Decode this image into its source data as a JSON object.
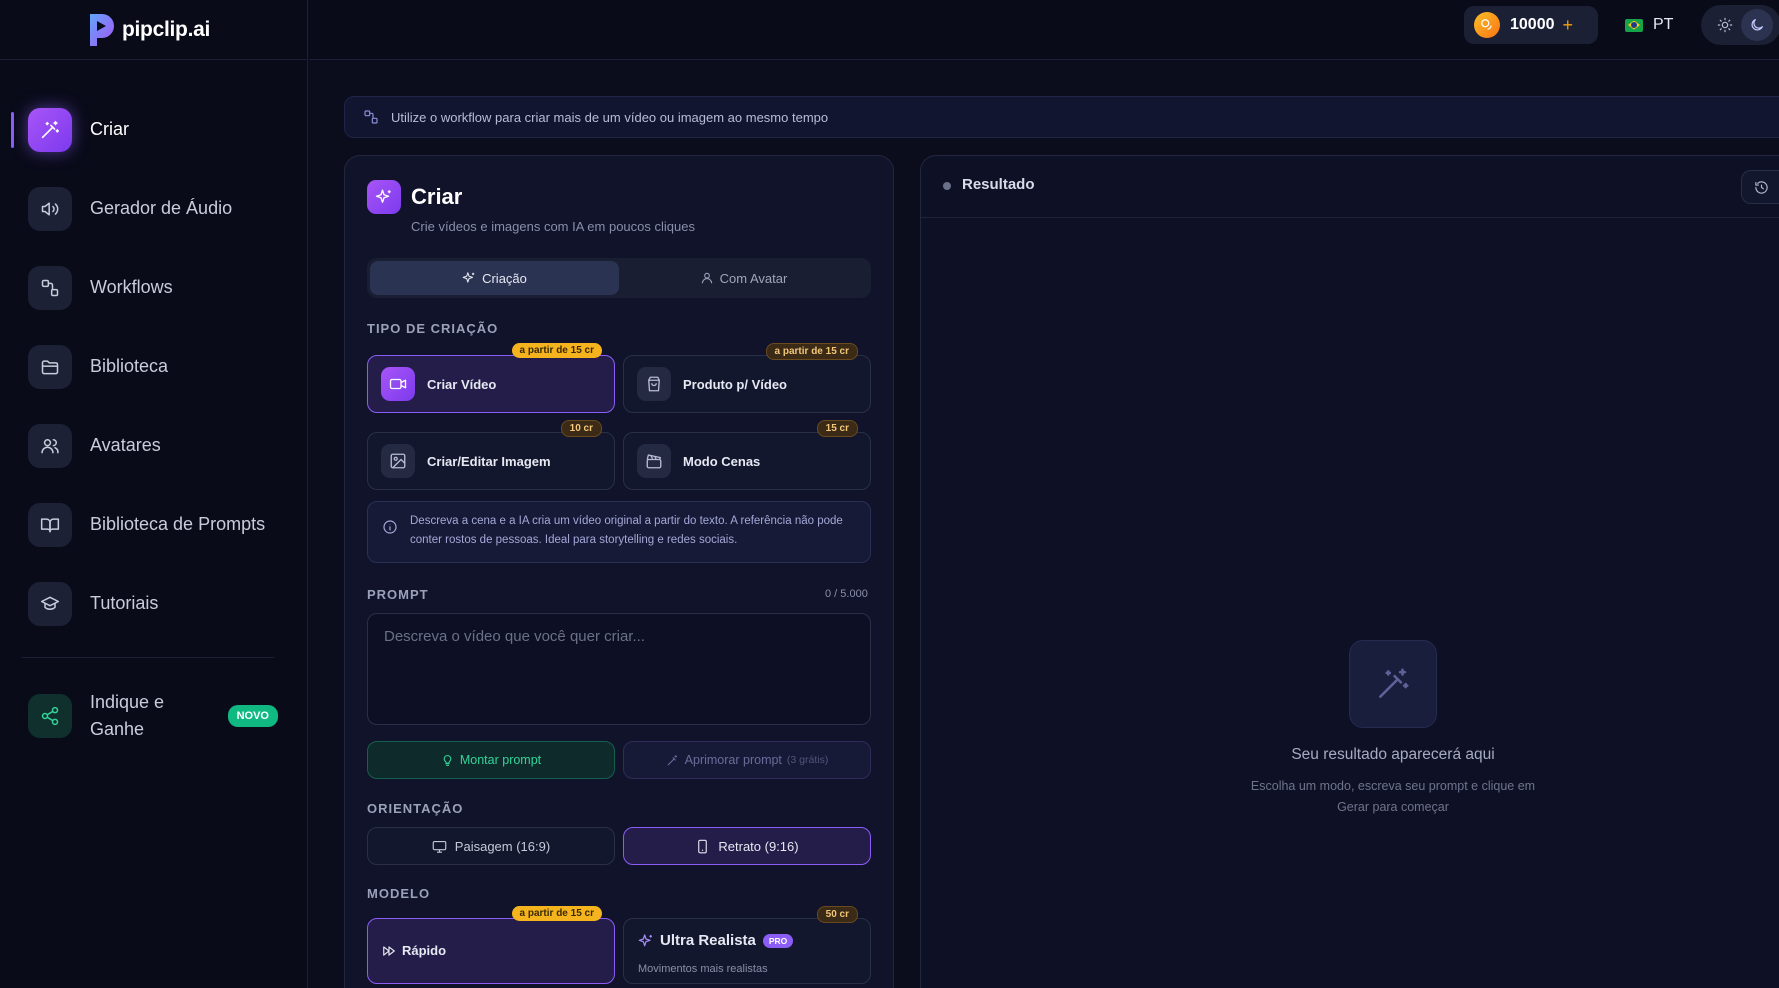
{
  "app": {
    "logo_text": "pipclip.ai"
  },
  "sidebar": {
    "items": [
      {
        "label": "Criar",
        "icon": "magic-wand-icon",
        "active": true
      },
      {
        "label": "Gerador de Áudio",
        "icon": "speaker-icon"
      },
      {
        "label": "Workflows",
        "icon": "workflow-icon"
      },
      {
        "label": "Biblioteca",
        "icon": "folder-icon"
      },
      {
        "label": "Avatares",
        "icon": "users-icon"
      },
      {
        "label": "Biblioteca de Prompts",
        "icon": "book-icon"
      },
      {
        "label": "Tutoriais",
        "icon": "graduation-cap-icon"
      }
    ],
    "refer": {
      "label": "Indique e Ganhe",
      "badge": "NOVO",
      "icon": "share-icon"
    }
  },
  "topbar": {
    "credits": "10000",
    "language": "PT",
    "theme_mode": "dark"
  },
  "hint": {
    "text": "Utilize o workflow para criar mais de um vídeo ou imagem ao mesmo tempo"
  },
  "create_panel": {
    "title": "Criar",
    "subtitle": "Crie vídeos e imagens com IA em poucos cliques",
    "tabs": [
      {
        "label": "Criação",
        "active": true
      },
      {
        "label": "Com Avatar",
        "active": false
      }
    ],
    "creation_type_label": "TIPO DE CRIAÇÃO",
    "creation_types": [
      {
        "label": "Criar Vídeo",
        "price": "a partir de 15 cr",
        "selected": true
      },
      {
        "label": "Produto p/ Vídeo",
        "price": "a partir de 15 cr",
        "selected": false
      },
      {
        "label": "Criar/Editar Imagem",
        "price": "10 cr",
        "selected": false
      },
      {
        "label": "Modo Cenas",
        "price": "15 cr",
        "selected": false
      }
    ],
    "info_text": "Descreva a cena e a IA cria um vídeo original a partir do texto. A referência não pode conter rostos de pessoas. Ideal para storytelling e redes sociais.",
    "prompt_label": "PROMPT",
    "prompt_counter": "0 / 5.000",
    "prompt_placeholder": "Descreva o vídeo que você quer criar...",
    "prompt_value": "",
    "build_prompt": "Montar prompt",
    "improve_prompt": "Aprimorar prompt",
    "improve_note": "(3 grátis)",
    "orientation_label": "ORIENTAÇÃO",
    "orientations": [
      {
        "label": "Paisagem (16:9)",
        "selected": false
      },
      {
        "label": "Retrato (9:16)",
        "selected": true
      }
    ],
    "model_label": "MODELO",
    "models": [
      {
        "label": "Rápido",
        "price": "a partir de 15 cr",
        "selected": true
      },
      {
        "label": "Ultra Realista",
        "badge": "PRO",
        "price": "50 cr",
        "subtitle": "Movimentos mais realistas",
        "selected": false
      }
    ]
  },
  "result_panel": {
    "title": "Resultado",
    "empty_title": "Seu resultado aparecerá aqui",
    "empty_subtitle": "Escolha um modo, escreva seu prompt e clique em Gerar para começar"
  },
  "colors": {
    "accent": "#8b5cf6",
    "success": "#10b981",
    "credit": "#f59e0b",
    "background": "#0b0d1c"
  }
}
